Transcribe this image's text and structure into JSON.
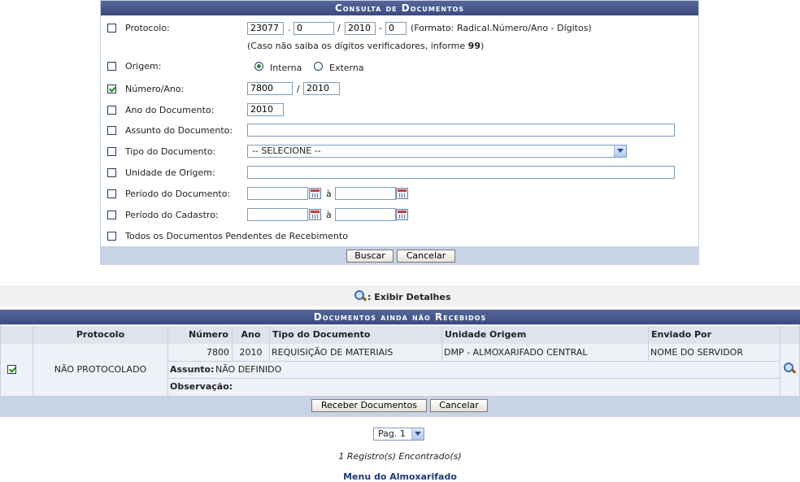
{
  "form": {
    "title": "Consulta de Documentos",
    "protocolo": {
      "label": "Protocolo:",
      "radical": "23077",
      "numero": "0",
      "ano": "2010",
      "digitos": "0",
      "sep_dot": ".",
      "sep_slash": "/",
      "sep_dash": "-",
      "format_hint": "(Formato: Radical.Número/Ano - Dígitos)",
      "note_prefix": "(Caso não saiba os dígitos verificadores, informe ",
      "note_bold": "99",
      "note_suffix": ")"
    },
    "origem": {
      "label": "Origem:",
      "option_interna": "Interna",
      "option_externa": "Externa"
    },
    "numero_ano": {
      "label": "Número/Ano:",
      "numero": "7800",
      "sep": "/",
      "ano": "2010"
    },
    "ano_documento": {
      "label": "Ano do Documento:",
      "value": "2010"
    },
    "assunto": {
      "label": "Assunto do Documento:",
      "value": ""
    },
    "tipo": {
      "label": "Tipo do Documento:",
      "selected": "-- SELECIONE --"
    },
    "unidade": {
      "label": "Unidade de Origem:",
      "value": ""
    },
    "periodo_documento": {
      "label": "Período do Documento:",
      "sep": "à"
    },
    "periodo_cadastro": {
      "label": "Período do Cadastro:",
      "sep": "à"
    },
    "pendentes": {
      "label": "Todos os Documentos Pendentes de Recebimento"
    },
    "buttons": {
      "search": "Buscar",
      "cancel": "Cancelar"
    }
  },
  "legend": {
    "label": ": Exibir Detalhes"
  },
  "results": {
    "title": "Documentos ainda não Recebidos",
    "headers": [
      "Protocolo",
      "Número",
      "Ano",
      "Tipo do Documento",
      "Unidade Origem",
      "Enviado Por"
    ],
    "row": {
      "protocolo": "NÃO PROTOCOLADO",
      "numero": "7800",
      "ano": "2010",
      "tipo": "REQUISIÇÃO DE MATERIAIS",
      "unidade": "DMP - ALMOXARIFADO CENTRAL",
      "enviado_por": "NOME DO SERVIDOR",
      "assunto_label": "Assunto:",
      "assunto_value": "NÃO DEFINIDO",
      "observacao_label": "Observação:"
    },
    "buttons": {
      "receive": "Receber Documentos",
      "cancel": "Cancelar"
    }
  },
  "pagination": {
    "selected": "Pag. 1"
  },
  "status": {
    "records": "1 Registro(s) Encontrado(s)"
  },
  "footer": {
    "menu_link": "Menu do Almoxarifado"
  }
}
